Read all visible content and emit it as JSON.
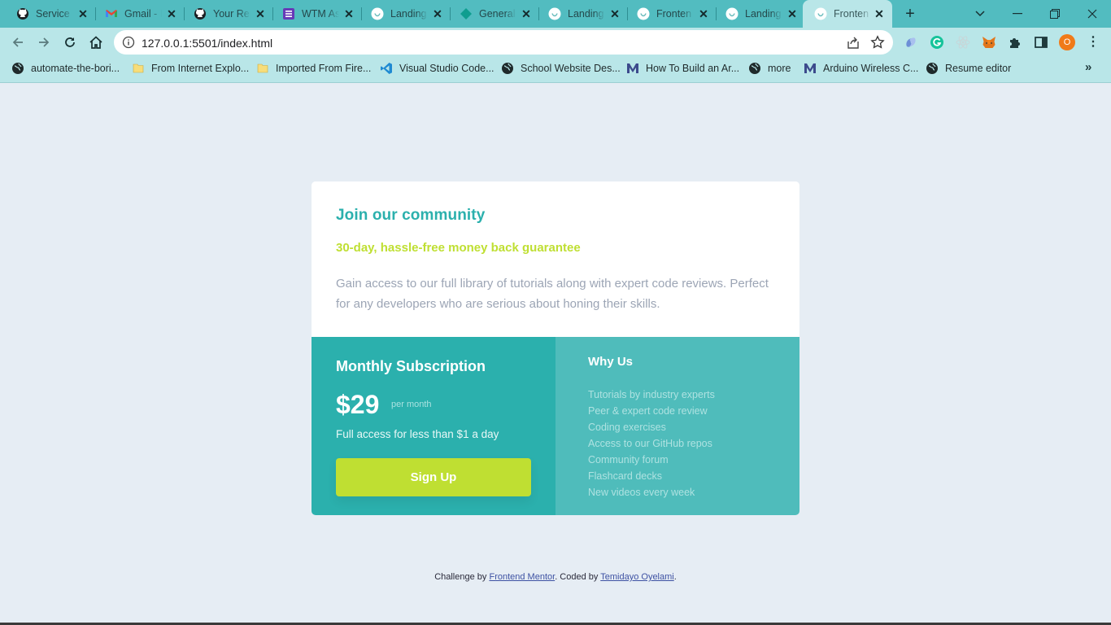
{
  "browser": {
    "tabs": [
      {
        "title": "Service F",
        "icon": "github-icon"
      },
      {
        "title": "Gmail - I",
        "icon": "gmail-icon"
      },
      {
        "title": "Your Rep",
        "icon": "github-icon"
      },
      {
        "title": "WTM As",
        "icon": "forms-icon"
      },
      {
        "title": "Landing",
        "icon": "page-icon"
      },
      {
        "title": "General",
        "icon": "diamond-icon"
      },
      {
        "title": "Landing",
        "icon": "page-icon"
      },
      {
        "title": "Fronten",
        "icon": "page-icon"
      },
      {
        "title": "Landing",
        "icon": "page-icon"
      },
      {
        "title": "Fronten",
        "icon": "page-icon",
        "active": true
      }
    ],
    "close_glyph": "✕",
    "new_tab_glyph": "+",
    "url": "127.0.0.1:5501/index.html",
    "avatar_letter": "O",
    "bookmarks": [
      {
        "label": "automate-the-bori...",
        "icon": "globe-icon"
      },
      {
        "label": "From Internet Explo...",
        "icon": "folder-icon"
      },
      {
        "label": "Imported From Fire...",
        "icon": "folder-icon"
      },
      {
        "label": "Visual Studio Code...",
        "icon": "vscode-icon"
      },
      {
        "label": "School Website Des...",
        "icon": "globe-icon"
      },
      {
        "label": "How To Build an Ar...",
        "icon": "medium-icon"
      },
      {
        "label": "more",
        "icon": "globe-icon"
      },
      {
        "label": "Arduino Wireless C...",
        "icon": "medium-icon"
      },
      {
        "label": "Resume editor",
        "icon": "globe-icon"
      }
    ],
    "bookmarks_overflow": "»"
  },
  "card": {
    "heading": "Join our community",
    "guarantee": "30-day, hassle-free money back guarantee",
    "description": "Gain access to our full library of tutorials along with expert code reviews. Perfect for any developers who are serious about honing their skills.",
    "subscription": {
      "title": "Monthly Subscription",
      "price": "$29",
      "period": "per month",
      "note": "Full access for less than $1 a day",
      "button": "Sign Up"
    },
    "why": {
      "title": "Why Us",
      "items": [
        "Tutorials by industry experts",
        "Peer & expert code review",
        "Coding exercises",
        "Access to our GitHub repos",
        "Community forum",
        "Flashcard decks",
        "New videos every week"
      ]
    }
  },
  "attribution": {
    "prefix": "Challenge by ",
    "link1": "Frontend Mentor",
    "middle": ". Coded by ",
    "link2": "Temidayo Oyelami",
    "suffix": "."
  },
  "colors": {
    "teal": "#2bb0ad",
    "teal_light": "#4fbcbb",
    "lime": "#bfdf32",
    "gray_text": "#9ca5b5",
    "page_bg": "#e6edf4"
  }
}
